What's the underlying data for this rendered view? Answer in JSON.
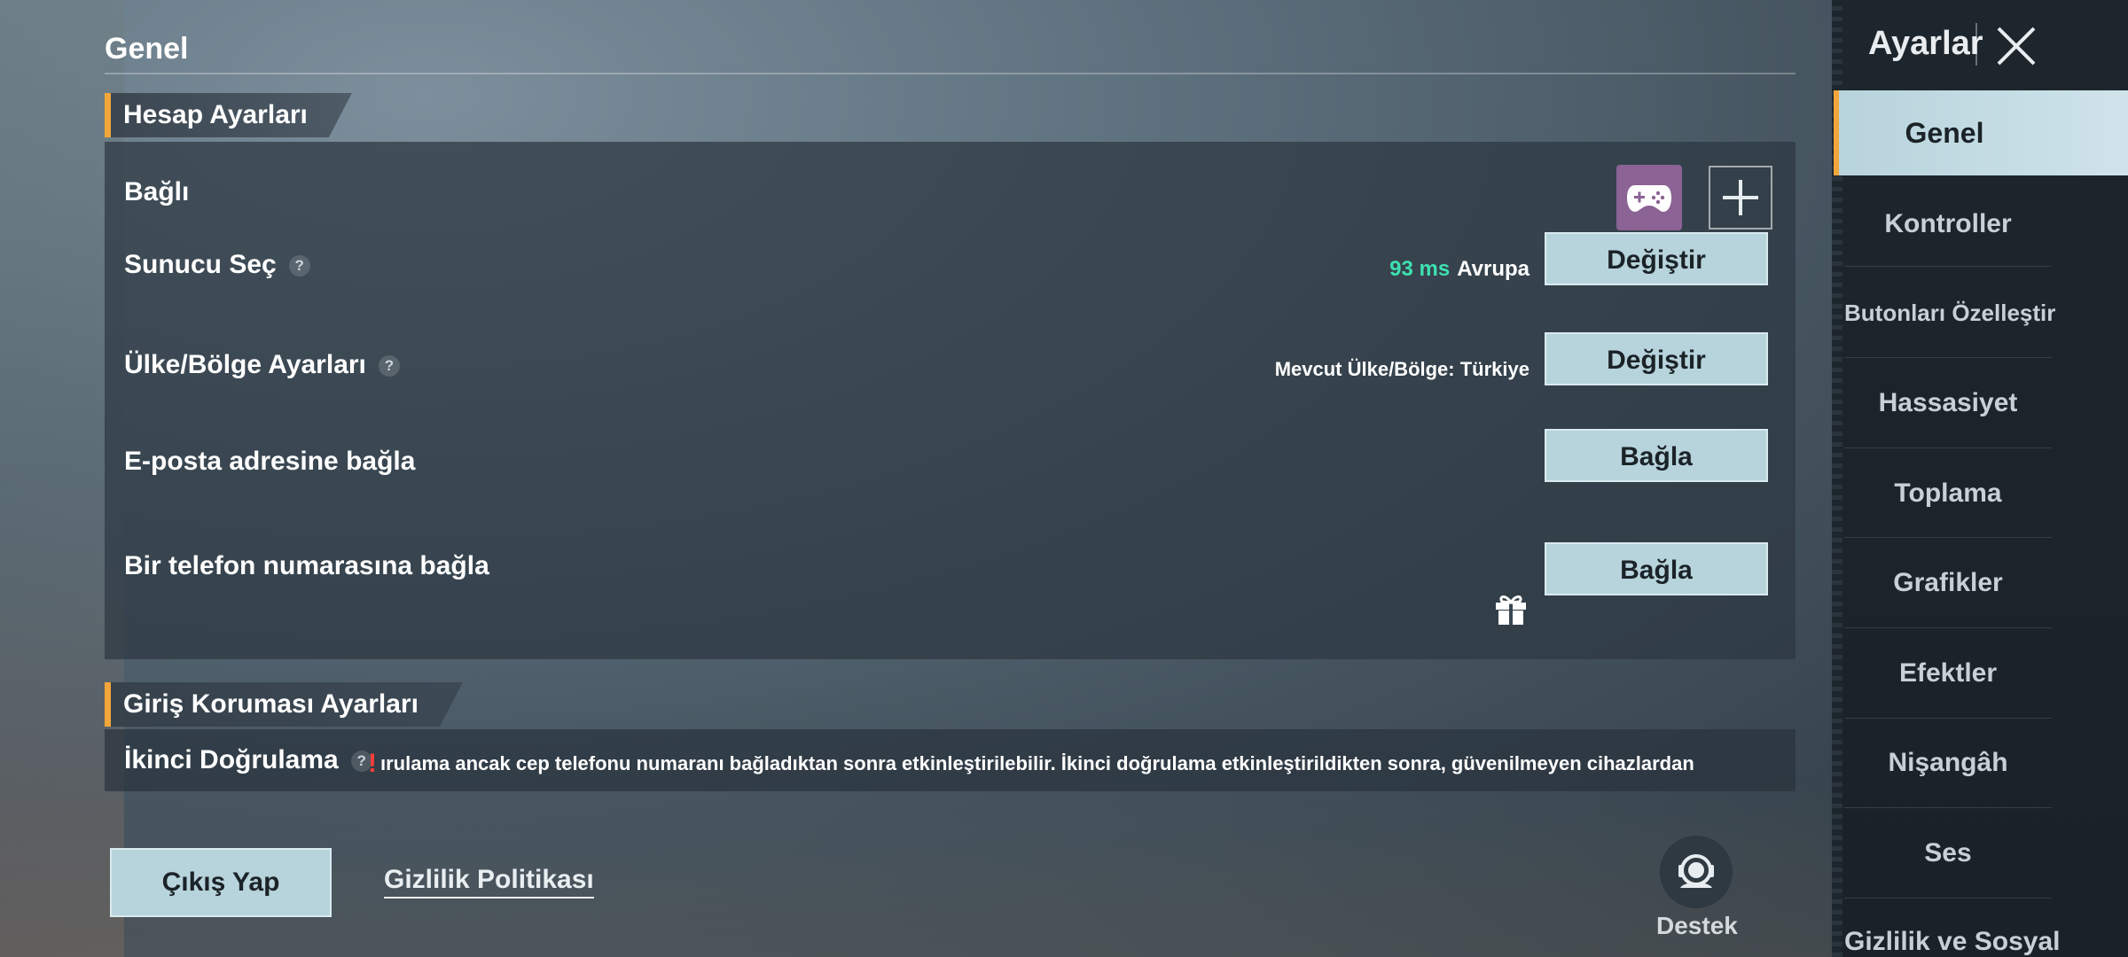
{
  "main": {
    "section_title": "Genel",
    "account_group": {
      "title": "Hesap Ayarları",
      "linked_label": "Bağlı",
      "server_label": "Sunucu Seç",
      "ping_value": "93 ms",
      "region": "Avrupa",
      "server_button": "Değiştir",
      "country_label": "Ülke/Bölge Ayarları",
      "country_current": "Mevcut Ülke/Bölge: Türkiye",
      "country_button": "Değiştir",
      "email_label": "E-posta adresine bağla",
      "email_button": "Bağla",
      "phone_label": "Bir telefon numarasına bağla",
      "phone_button": "Bağla"
    },
    "login_group": {
      "title": "Giriş Koruması Ayarları",
      "second_auth_label": "İkinci Doğrulama",
      "second_auth_message": "ırulama ancak cep telefonu numaranı bağladıktan sonra etkinleştirilebilir. İkinci doğrulama etkinleştirildikten sonra, güvenilmeyen cihazlardan",
      "warning_mark": "!"
    },
    "help_mark": "?",
    "exit_button": "Çıkış Yap",
    "privacy_link": "Gizlilik Politikası",
    "support_label": "Destek"
  },
  "sidebar": {
    "title": "Ayarlar",
    "items": [
      {
        "label": "Genel",
        "active": true
      },
      {
        "label": "Kontroller"
      },
      {
        "label": "Butonları Özelleştir"
      },
      {
        "label": "Hassasiyet"
      },
      {
        "label": "Toplama"
      },
      {
        "label": "Grafikler"
      },
      {
        "label": "Efektler"
      },
      {
        "label": "Nişangâh"
      },
      {
        "label": "Ses"
      },
      {
        "label": "Gizlilik ve Sosyal"
      }
    ]
  },
  "colors": {
    "accent": "#f3a63a",
    "button": "#b7d3dc",
    "ping": "#3ee0b0",
    "warning": "#ff3b3b",
    "gamepad": "#8b6394"
  },
  "icons": [
    "gamepad-icon",
    "plus-icon",
    "help-icon",
    "gift-icon",
    "warning-icon",
    "headset-icon",
    "close-icon"
  ]
}
